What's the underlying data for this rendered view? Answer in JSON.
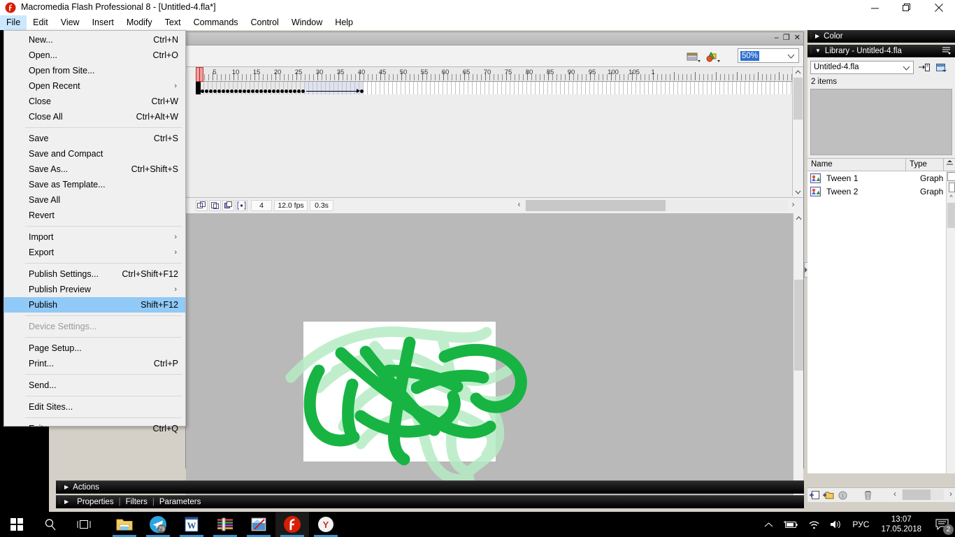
{
  "window": {
    "title": "Macromedia Flash Professional 8 - [Untitled-4.fla*]",
    "app_icon": "flash-icon",
    "minimize": "minimize-icon",
    "maximize": "restore-icon",
    "close": "close-icon"
  },
  "menubar": {
    "items": [
      {
        "label": "File",
        "open": true
      },
      {
        "label": "Edit",
        "open": false
      },
      {
        "label": "View",
        "open": false
      },
      {
        "label": "Insert",
        "open": false
      },
      {
        "label": "Modify",
        "open": false
      },
      {
        "label": "Text",
        "open": false
      },
      {
        "label": "Commands",
        "open": false
      },
      {
        "label": "Control",
        "open": false
      },
      {
        "label": "Window",
        "open": false
      },
      {
        "label": "Help",
        "open": false
      }
    ]
  },
  "file_menu": {
    "items": [
      {
        "label": "New...",
        "accel": "Ctrl+N",
        "type": "item"
      },
      {
        "label": "Open...",
        "accel": "Ctrl+O",
        "type": "item"
      },
      {
        "label": "Open from Site...",
        "accel": "",
        "type": "item"
      },
      {
        "label": "Open Recent",
        "accel": "",
        "type": "submenu"
      },
      {
        "label": "Close",
        "accel": "Ctrl+W",
        "type": "item"
      },
      {
        "label": "Close All",
        "accel": "Ctrl+Alt+W",
        "type": "item"
      },
      {
        "type": "separator"
      },
      {
        "label": "Save",
        "accel": "Ctrl+S",
        "type": "item"
      },
      {
        "label": "Save and Compact",
        "accel": "",
        "type": "item"
      },
      {
        "label": "Save As...",
        "accel": "Ctrl+Shift+S",
        "type": "item"
      },
      {
        "label": "Save as Template...",
        "accel": "",
        "type": "item"
      },
      {
        "label": "Save All",
        "accel": "",
        "type": "item"
      },
      {
        "label": "Revert",
        "accel": "",
        "type": "item"
      },
      {
        "type": "separator"
      },
      {
        "label": "Import",
        "accel": "",
        "type": "submenu"
      },
      {
        "label": "Export",
        "accel": "",
        "type": "submenu"
      },
      {
        "type": "separator"
      },
      {
        "label": "Publish Settings...",
        "accel": "Ctrl+Shift+F12",
        "type": "item"
      },
      {
        "label": "Publish Preview",
        "accel": "",
        "type": "submenu"
      },
      {
        "label": "Publish",
        "accel": "Shift+F12",
        "type": "item",
        "highlight": true
      },
      {
        "type": "separator"
      },
      {
        "label": "Device Settings...",
        "accel": "",
        "type": "item",
        "disabled": true
      },
      {
        "type": "separator"
      },
      {
        "label": "Page Setup...",
        "accel": "",
        "type": "item"
      },
      {
        "label": "Print...",
        "accel": "Ctrl+P",
        "type": "item"
      },
      {
        "type": "separator"
      },
      {
        "label": "Send...",
        "accel": "",
        "type": "item"
      },
      {
        "type": "separator"
      },
      {
        "label": "Edit Sites...",
        "accel": "",
        "type": "item"
      },
      {
        "type": "separator"
      },
      {
        "label": "Exit",
        "accel": "Ctrl+Q",
        "type": "item"
      }
    ]
  },
  "document": {
    "minimize": "minimize-icon",
    "restore": "restore-icon",
    "close": "close-icon",
    "edit_scene_icon": "edit-scene-icon",
    "edit_symbols_icon": "edit-symbols-icon",
    "zoom": {
      "value": "50%",
      "caret": "chevron-down-icon"
    }
  },
  "timeline": {
    "ruler_labels": [
      5,
      10,
      15,
      20,
      25,
      30,
      35,
      40,
      45,
      50,
      55,
      60,
      65,
      70,
      75,
      80,
      85,
      90,
      95,
      100,
      105
    ],
    "ruler_last_partial": "1",
    "playhead_frame": 1,
    "keyframe_count": 26,
    "tween_start_frame": 27,
    "tween_end_frame": 40,
    "status": {
      "center_frame_icon": "center-frame-icon",
      "onion_skin_icon": "onion-skin-icon",
      "onion_skin_outlines_icon": "onion-skin-outlines-icon",
      "edit_multiple_frames_icon": "edit-multiple-frames-icon",
      "current_frame": "4",
      "frame_rate": "12.0 fps",
      "elapsed_time": "0.3s"
    }
  },
  "stage": {
    "background": "#ffffff",
    "artwork": "green-scribble-drawing",
    "artwork_colors": {
      "solid": "#17b443",
      "ghost": "#b6ecc4"
    },
    "workspace_color": "#b9b9b9"
  },
  "bottom_panels": [
    {
      "label": "Actions",
      "expanded": false,
      "arrow": "triangle-right-icon"
    },
    {
      "label": "Properties",
      "tabs": [
        "Properties",
        "Filters",
        "Parameters"
      ],
      "expanded": false,
      "arrow": "triangle-right-icon"
    }
  ],
  "right_dock": {
    "color_panel": {
      "label": "Color",
      "arrow": "triangle-right-icon",
      "expanded": false
    },
    "library_panel": {
      "label": "Library - Untitled-4.fla",
      "arrow": "triangle-down-icon",
      "options_icon": "panel-options-icon",
      "document_select": {
        "value": "Untitled-4.fla",
        "caret": "chevron-down-icon"
      },
      "pin_icon": "pin-current-library-icon",
      "new_library_icon": "new-library-panel-icon",
      "item_count": "2 items",
      "columns": [
        "Name",
        "Type"
      ],
      "sort_icon": "sort-order-icon",
      "items": [
        {
          "icon": "graphic-symbol-icon",
          "name": "Tween 1",
          "type": "Graph"
        },
        {
          "icon": "graphic-symbol-icon",
          "name": "Tween 2",
          "type": "Graph"
        }
      ],
      "footer": {
        "new_symbol_icon": "new-symbol-icon",
        "new_folder_icon": "new-folder-icon",
        "properties_icon": "item-properties-icon",
        "delete_icon": "trash-icon"
      }
    }
  },
  "taskbar": {
    "start": "windows-start-icon",
    "search": "search-icon",
    "task_view": "task-view-icon",
    "apps": [
      {
        "icon": "file-explorer-icon",
        "running": true,
        "active": false
      },
      {
        "icon": "telegram-icon",
        "running": true,
        "active": false,
        "badge": "79"
      },
      {
        "icon": "word-icon",
        "running": true,
        "active": false
      },
      {
        "icon": "winrar-icon",
        "running": true,
        "active": false
      },
      {
        "icon": "paint-icon",
        "running": true,
        "active": false
      },
      {
        "icon": "flash-icon",
        "running": true,
        "active": true
      },
      {
        "icon": "yandex-browser-icon",
        "running": true,
        "active": false
      }
    ],
    "tray": {
      "show_hidden_icon": "chevron-up-icon",
      "battery_icon": "battery-charging-icon",
      "network_icon": "wifi-icon",
      "volume_icon": "speaker-icon",
      "language": "РУС",
      "time": "13:07",
      "date": "17.05.2018",
      "notifications_icon": "action-center-icon",
      "notifications_count": "2"
    }
  }
}
